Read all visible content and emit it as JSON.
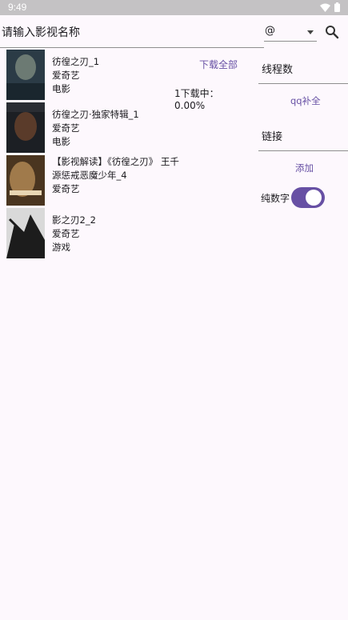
{
  "status_bar": {
    "time": "9:49"
  },
  "search": {
    "placeholder": "请输入影视名称",
    "value": ""
  },
  "site_select": {
    "value": "@"
  },
  "results": [
    {
      "title": "彷徨之刃_1",
      "source": "爱奇艺",
      "category": "电影",
      "poster_colors": [
        "#2b3b46",
        "#6c7a73"
      ]
    },
    {
      "title": "彷徨之刃·独家特辑_1",
      "source": "爱奇艺",
      "category": "电影",
      "poster_colors": [
        "#1c1f24",
        "#5a3b2a"
      ]
    },
    {
      "title": "【影视解读】《彷徨之刃》 王千源惩戒恶魔少年_4",
      "source": "爱奇艺",
      "category": "",
      "poster_colors": [
        "#4a3520",
        "#a07a4b"
      ]
    },
    {
      "title": "影之刃2_2",
      "source": "爱奇艺",
      "category": "游戏",
      "poster_colors": [
        "#d9d9d9",
        "#1c1c1c"
      ]
    }
  ],
  "download_all_label": "下载全部",
  "progress_text": "1下载中：0.00%",
  "panel": {
    "threads_label": "线程数",
    "qq_fill_label": "qq补全",
    "link_label": "链接",
    "add_label": "添加",
    "numeric_only_label": "纯数字",
    "numeric_only_on": true
  },
  "colors": {
    "accent": "#6750a4",
    "background": "#fdf8fd",
    "status_bar": "#c4c2c4"
  },
  "icons": [
    "wifi-icon",
    "battery-icon",
    "search-icon",
    "dropdown-caret-icon"
  ]
}
